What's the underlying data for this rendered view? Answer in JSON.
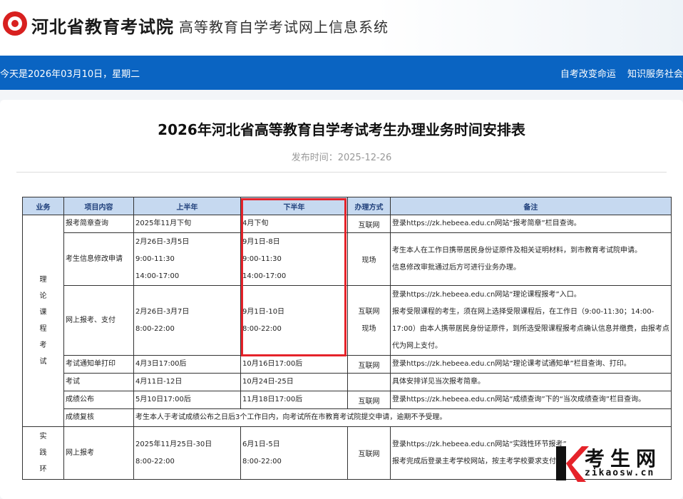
{
  "header": {
    "site_name": "河北省教育考试院",
    "site_sub": "高等教育自学考试网上信息系统"
  },
  "navbar": {
    "today": "今天是2026年03月10日，星期二",
    "links": [
      "自考改变命运",
      "知识服务社会"
    ]
  },
  "article": {
    "title": "2026年河北省高等教育自学考试考生办理业务时间安排表",
    "pub_label": "发布时间：",
    "pub_date": "2025-12-26"
  },
  "table": {
    "headers": [
      "业务",
      "项目内容",
      "上半年",
      "下半年",
      "办理方式",
      "备注"
    ],
    "group_theory": [
      "理",
      "论",
      "课",
      "程",
      "考",
      "试"
    ],
    "group_practice": [
      "实",
      "践",
      "环"
    ],
    "rows": [
      {
        "item": "报考简章查询",
        "h1": [
          "2025年11月下旬"
        ],
        "h2": [
          "4月下旬"
        ],
        "way": [
          "互联网"
        ],
        "note": [
          "登录https://zk.hebeea.edu.cn网站“报考简章”栏目查询。"
        ]
      },
      {
        "item": "考生信息修改申请",
        "h1": [
          "2月26日-3月5日",
          "9:00-11:30",
          "14:00-17:00"
        ],
        "h2": [
          "9月1日-8日",
          "9:00-11:30",
          "14:00-17:00"
        ],
        "way": [
          "现场"
        ],
        "note": [
          "考生本人在工作日携带居民身份证原件及相关证明材料，到市教育考试院申请。",
          "信息修改审批通过后方可进行业务办理。"
        ]
      },
      {
        "item": "网上报考、支付",
        "h1": [
          "2月26日-3月7日",
          "8:00-22:00"
        ],
        "h2": [
          "9月1日-10日",
          "8:00-22:00"
        ],
        "way": [
          "互联网",
          "现场"
        ],
        "note": [
          "登录https://zk.hebeea.edu.cn网站“理论课程报考”入口。",
          "报考受限课程的考生，须在网上选择受限课程后，在工作日（9:00-11:30；14:00-",
          "17:00）由本人携带居民身份证原件，到所选受限课程报考点确认信息并缴费，由报考点",
          "代为网上支付。"
        ]
      },
      {
        "item": "考试通知单打印",
        "h1": [
          "4月3日17:00后"
        ],
        "h2": [
          "10月16日17:00后"
        ],
        "way": [
          "互联网"
        ],
        "note": [
          "登录https://zk.hebeea.edu.cn网站“理论课考试通知单”栏目查询、打印。"
        ]
      },
      {
        "item": "考试",
        "h1": [
          "4月11日-12日"
        ],
        "h2": [
          "10月24日-25日"
        ],
        "way": [
          ""
        ],
        "note": [
          "具体安排详见当次报考简章。"
        ]
      },
      {
        "item": "成绩公布",
        "h1": [
          "5月10日17:00后"
        ],
        "h2": [
          "11月18日17:00后"
        ],
        "way": [
          "互联网"
        ],
        "note": [
          "登录https://zk.hebeea.edu.cn网站“成绩查询”下的“当次成绩查询”栏目查询。"
        ]
      },
      {
        "item": "成绩复核",
        "span": "考生本人于考试成绩公布之日后3个工作日内，向考试所在市教育考试院提交申请，逾期不予受理。"
      },
      {
        "item": "网上报考",
        "h1": [
          "2025年11月25日-30日",
          "8:00-22:00"
        ],
        "h2": [
          "6月1日-5日",
          "8:00-22:00"
        ],
        "way": [
          "互联网"
        ],
        "note": [
          "登录https://zk.hebeea.edu.cn网站“实践性环节报考”",
          "报考完成后登录主考学校网站，按主考学校要求支付。"
        ]
      }
    ]
  },
  "watermark": {
    "brand": "考生网",
    "url": "zikaosw.cn"
  },
  "colors": {
    "nav_blue": "#0a64c2",
    "header_blue": "#c6d9f0",
    "highlight_red": "#e5232a",
    "logo_red": "#d8201f"
  }
}
